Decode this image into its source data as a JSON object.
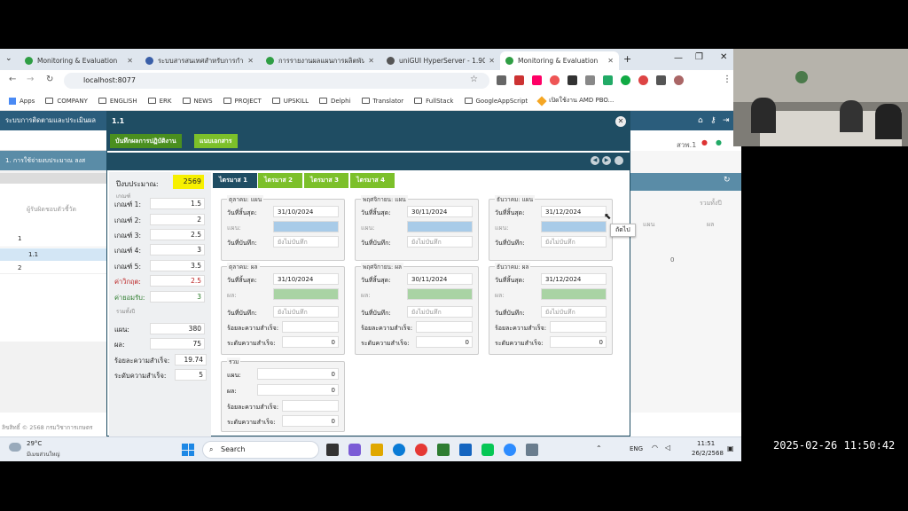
{
  "browser": {
    "tabs": [
      {
        "label": "Monitoring & Evaluation",
        "color": "#2f9e44"
      },
      {
        "label": "ระบบสารสนเทศสำหรับการกำกับติ",
        "color": "#3a5fa8"
      },
      {
        "label": "การรายงานผลแผนการผลิตพันธุ์",
        "color": "#2f9e44"
      },
      {
        "label": "uniGUI HyperServer - 1.90.0",
        "color": "#555555"
      },
      {
        "label": "Monitoring & Evaluation",
        "color": "#2f9e44"
      }
    ],
    "url": "localhost:8077",
    "bookmarks": [
      "Apps",
      "COMPANY",
      "ENGLISH",
      "ERK",
      "NEWS",
      "PROJECT",
      "UPSKILL",
      "Delphi",
      "Translator",
      "FullStack",
      "GoogleAppScript",
      "เปิดใช้งาน AMD PBO..."
    ]
  },
  "app": {
    "header": "ระบบการติดตามและประเมินผล",
    "subheader": "1. การใช้จ่ายงบประมาณ ลงส",
    "left_col": "ผู้รับผิดชอบตัวชี้วัด",
    "rows": [
      "1",
      "1.1",
      "2"
    ],
    "right_top": "สวพ.1",
    "right_label": "รวมทั้งปี",
    "right_cols": [
      "แผน",
      "ผล"
    ],
    "right_value": "0",
    "footer": "ลิขสิทธิ์ © 2568 กรมวิชาการเกษตร"
  },
  "modal": {
    "title": "1.1",
    "tabs": [
      "บันทึกผลการปฏิบัติงาน",
      "แนบเอกสาร"
    ],
    "tooltip": "ถัดไป",
    "year_label": "ปีงบประมาณ:",
    "year": "2569",
    "criteria_caption": "เกณฑ์",
    "criteria": [
      {
        "label": "เกณฑ์ 1:",
        "value": "1.5"
      },
      {
        "label": "เกณฑ์ 2:",
        "value": "2"
      },
      {
        "label": "เกณฑ์ 3:",
        "value": "2.5"
      },
      {
        "label": "เกณฑ์ 4:",
        "value": "3"
      },
      {
        "label": "เกณฑ์ 5:",
        "value": "3.5"
      },
      {
        "label": "ค่าวิกฤต:",
        "value": "2.5"
      },
      {
        "label": "ค่ายอมรับ:",
        "value": "3"
      }
    ],
    "summary_caption": "รวมทั้งปี",
    "summary": [
      {
        "label": "แผน:",
        "value": "380"
      },
      {
        "label": "ผล:",
        "value": "75"
      },
      {
        "label": "ร้อยละความสำเร็จ:",
        "value": "19.74"
      },
      {
        "label": "ระดับความสำเร็จ:",
        "value": "5"
      }
    ],
    "quarters": [
      "ไตรมาส 1",
      "ไตรมาส 2",
      "ไตรมาส 3",
      "ไตรมาส 4"
    ],
    "plan_boxes": [
      {
        "caption": "ตุลาคม: แผน",
        "end": "31/10/2024",
        "saved": "ยังไม่บันทึก"
      },
      {
        "caption": "พฤศจิกายน: แผน",
        "end": "30/11/2024",
        "saved": "ยังไม่บันทึก"
      },
      {
        "caption": "ธันวาคม: แผน",
        "end": "31/12/2024",
        "saved": "ยังไม่บันทึก"
      }
    ],
    "result_boxes": [
      {
        "caption": "ตุลาคม: ผล",
        "end": "31/10/2024",
        "saved": "ยังไม่บันทึก",
        "level": "0"
      },
      {
        "caption": "พฤศจิกายน: ผล",
        "end": "30/11/2024",
        "saved": "ยังไม่บันทึก",
        "level": "0"
      },
      {
        "caption": "ธันวาคม: ผล",
        "end": "31/12/2024",
        "saved": "ยังไม่บันทึก",
        "level": "0"
      }
    ],
    "field_labels": {
      "end": "วันที่สิ้นสุด:",
      "plan": "แผน:",
      "result": "ผล:",
      "saved": "วันที่บันทึก:",
      "pct": "ร้อยละความสำเร็จ:",
      "level": "ระดับความสำเร็จ:"
    },
    "total": {
      "caption": "รวม",
      "plan_label": "แผน:",
      "plan": "0",
      "result_label": "ผล:",
      "result": "0",
      "pct_label": "ร้อยละความสำเร็จ:",
      "level_label": "ระดับความสำเร็จ:",
      "level": "0"
    }
  },
  "taskbar": {
    "weather_temp": "29°C",
    "weather_text": "มีเมฆส่วนใหญ่",
    "search": "Search",
    "lang": "ENG",
    "time": "11:51",
    "date": "26/2/2568"
  },
  "timestamp": "2025-02-26 11:50:42",
  "colors": {
    "dark": "#1f4d63",
    "green_tab": "#7cc02a",
    "active_green": "#4a8f1f",
    "plan_fill": "#a8cbe8",
    "result_fill": "#a9d3a4",
    "year_bg": "#f7f000"
  }
}
